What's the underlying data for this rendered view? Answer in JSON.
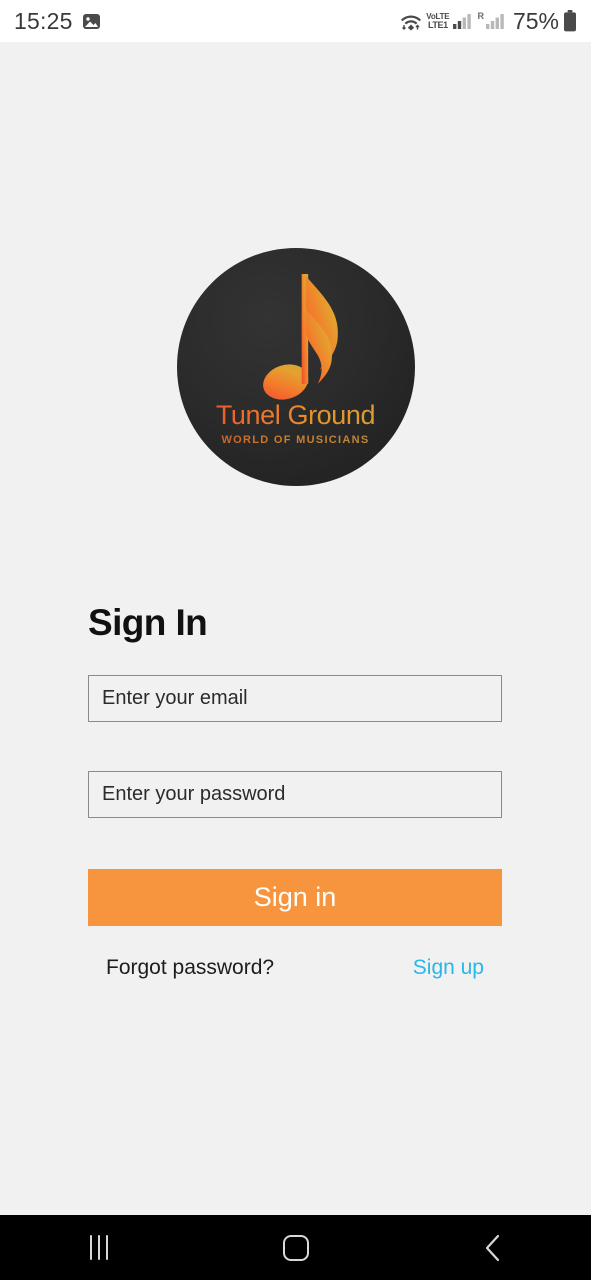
{
  "status_bar": {
    "time": "15:25",
    "photo_icon": "image-notification-icon",
    "wifi_icon": "wifi-data-icon",
    "volte_top": "VoLTE",
    "volte_bottom": "LTE1",
    "signal_icon": "signal-bars-icon",
    "roaming_label": "R",
    "roaming_signal_icon": "signal-bars-roaming-icon",
    "battery_percent": "75%",
    "battery_icon": "battery-icon"
  },
  "logo": {
    "icon": "music-note-icon",
    "title": "Tunel Ground",
    "subtitle": "WORLD OF MUSICIANS",
    "circle_color": "#2b2b2b",
    "accent_start": "#e8452f",
    "accent_end": "#d2a23a"
  },
  "form": {
    "heading": "Sign In",
    "email_placeholder": "Enter your email",
    "email_value": "",
    "password_placeholder": "Enter your password",
    "password_value": "",
    "submit_label": "Sign in",
    "submit_color": "#f7943e",
    "forgot_label": "Forgot password?",
    "signup_label": "Sign up",
    "signup_color": "#29b6e8"
  },
  "nav_bar": {
    "recents": "recents-icon",
    "home": "home-icon",
    "back": "back-icon"
  }
}
